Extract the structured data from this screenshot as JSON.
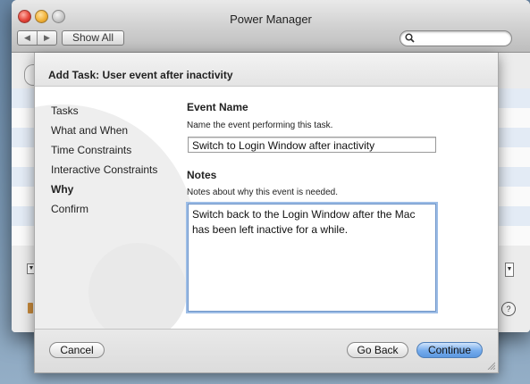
{
  "window": {
    "title": "Power Manager",
    "back_glyph": "◀",
    "forward_glyph": "▶",
    "show_all_label": "Show All",
    "search_placeholder": "",
    "search_icon": "magnifier-icon"
  },
  "sheet": {
    "title": "Add Task: User event after inactivity",
    "steps": [
      {
        "label": "Tasks",
        "current": false
      },
      {
        "label": "What and When",
        "current": false
      },
      {
        "label": "Time Constraints",
        "current": false
      },
      {
        "label": "Interactive Constraints",
        "current": false
      },
      {
        "label": "Why",
        "current": true
      },
      {
        "label": "Confirm",
        "current": false
      }
    ],
    "event_name": {
      "heading": "Event Name",
      "description": "Name the event performing this task.",
      "value": "Switch to Login Window after inactivity"
    },
    "notes": {
      "heading": "Notes",
      "description": "Notes about why this event is needed.",
      "value": "Switch back to the Login Window after the Mac has been left inactive for a while."
    },
    "buttons": {
      "cancel": "Cancel",
      "go_back": "Go Back",
      "continue": "Continue"
    }
  },
  "colors": {
    "desktop": "#7e9cb8",
    "primary_button": "#74abec",
    "focus_ring": "#9dbde6"
  }
}
